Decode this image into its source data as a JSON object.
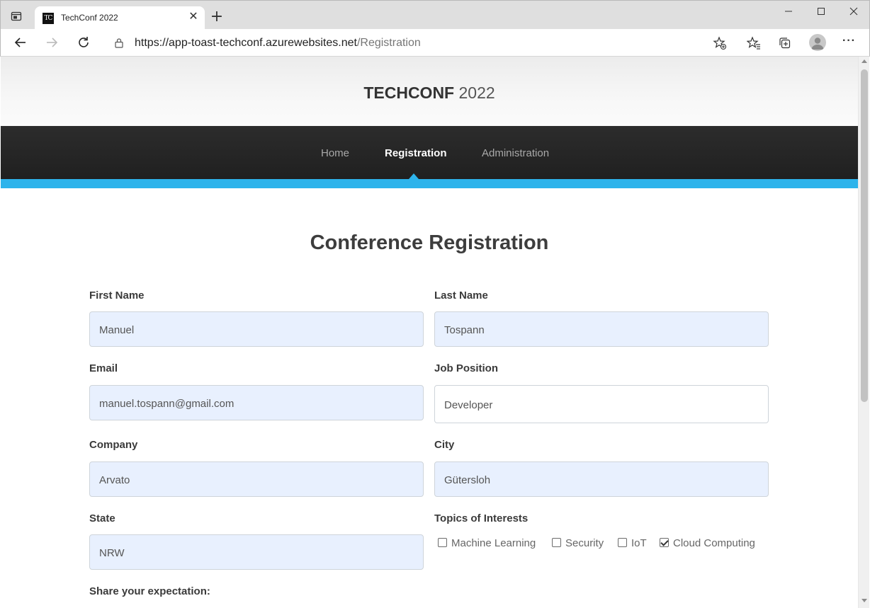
{
  "browser": {
    "tab_title": "TechConf 2022",
    "tab_favicon_text": "TC",
    "url_host": "https://app-toast-techconf.azurewebsites.net",
    "url_path": "/Registration",
    "icons": [
      "tab-actions-icon",
      "close-icon",
      "new-tab-icon",
      "minimize-icon",
      "maximize-icon",
      "window-close-icon",
      "back-icon",
      "forward-icon",
      "refresh-icon",
      "lock-icon",
      "add-favorite-icon",
      "favorites-icon",
      "collections-icon",
      "profile-icon",
      "more-icon"
    ]
  },
  "site": {
    "brand_strong": "TECHCONF",
    "brand_light": "2022",
    "nav": {
      "home": "Home",
      "registration": "Registration",
      "administration": "Administration"
    },
    "accent_color": "#2db3eb"
  },
  "form": {
    "title": "Conference Registration",
    "first_name": {
      "label": "First Name",
      "value": "Manuel"
    },
    "last_name": {
      "label": "Last Name",
      "value": "Tospann"
    },
    "email": {
      "label": "Email",
      "value": "manuel.tospann@gmail.com"
    },
    "job_position": {
      "label": "Job Position",
      "value": "Developer"
    },
    "company": {
      "label": "Company",
      "value": "Arvato"
    },
    "city": {
      "label": "City",
      "value": "Gütersloh"
    },
    "state": {
      "label": "State",
      "value": "NRW"
    },
    "topics": {
      "label": "Topics of Interests",
      "options": [
        {
          "label": "Machine Learning",
          "checked": false
        },
        {
          "label": "Security",
          "checked": false
        },
        {
          "label": "IoT",
          "checked": false
        },
        {
          "label": "Cloud Computing",
          "checked": true
        }
      ]
    },
    "expectation_label": "Share your expectation:"
  }
}
